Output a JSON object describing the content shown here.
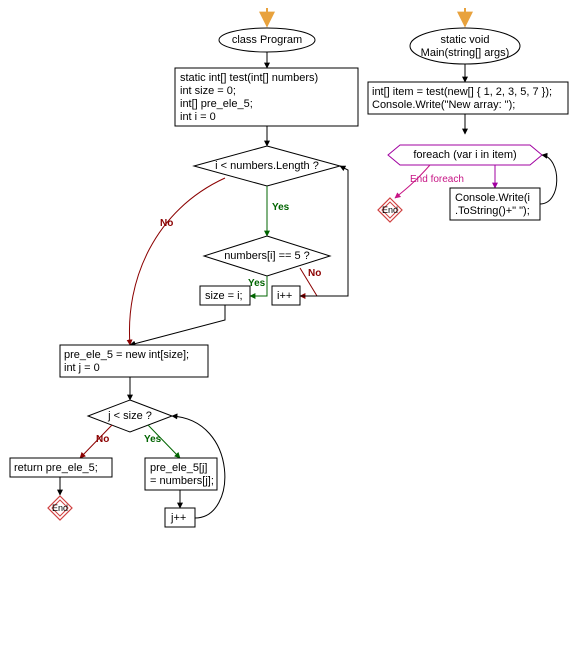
{
  "left": {
    "start": "class Program",
    "init": "static int[] test(int[] numbers)\nint size = 0;\nint[] pre_ele_5;\nint i = 0",
    "cond1": "i < numbers.Length ?",
    "cond2": "numbers[i] == 5 ?",
    "size_assign": "size = i;",
    "i_inc": "i++",
    "alloc": "pre_ele_5 = new int[size];\nint j = 0",
    "cond3": "j < size ?",
    "assign2": "pre_ele_5[j]\n= numbers[j];",
    "j_inc": "j++",
    "ret": "return pre_ele_5;",
    "end": "End"
  },
  "right": {
    "start": "static void\nMain(string[] args)",
    "init": "int[] item = test(new[] { 1, 2, 3, 5, 7 });\nConsole.Write(\"New array: \");",
    "foreach": "foreach (var i in item)",
    "body": "Console.Write(i\n.ToString()+\" \");",
    "end_foreach": "End foreach",
    "end": "End"
  },
  "labels": {
    "yes": "Yes",
    "no": "No"
  }
}
